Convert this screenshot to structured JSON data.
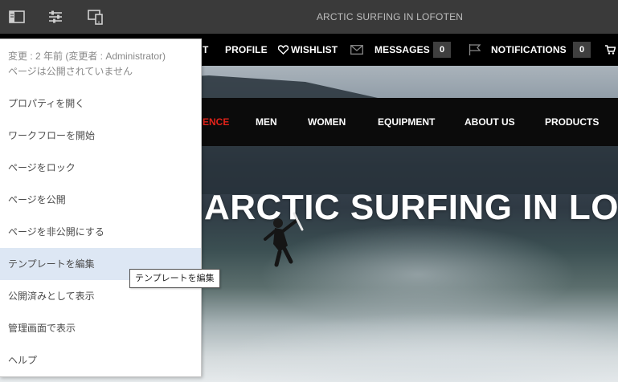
{
  "editor": {
    "page_title": "ARCTIC SURFING IN LOFOTEN",
    "icons": [
      "side-panel-icon",
      "page-properties-icon",
      "emulator-icon"
    ]
  },
  "topnav": {
    "partial_item": "T",
    "profile": "PROFILE",
    "wishlist": "WISHLIST",
    "messages": "MESSAGES",
    "messages_count": "0",
    "notifications": "NOTIFICATIONS",
    "notifications_count": "0"
  },
  "mainnav": {
    "active_partial": "ENCE",
    "items": [
      "MEN",
      "WOMEN",
      "EQUIPMENT",
      "ABOUT US",
      "PRODUCTS"
    ]
  },
  "hero": {
    "title": "ARCTIC SURFING IN LOFOTEN"
  },
  "menu": {
    "status": [
      "変更 : 2 年前 (変更者 : Administrator)",
      "ページは公開されていません"
    ],
    "items": [
      "プロパティを開く",
      "ワークフローを開始",
      "ページをロック",
      "ページを公開",
      "ページを非公開にする",
      "テンプレートを編集",
      "公開済みとして表示",
      "管理画面で表示",
      "ヘルプ"
    ],
    "hovered_index": 5,
    "tooltip": "テンプレートを編集"
  },
  "colors": {
    "toolbar_bg": "#3a3a3a",
    "nav_bg": "#000000",
    "active_nav": "#e2231a",
    "menu_hover": "#dde7f4"
  }
}
